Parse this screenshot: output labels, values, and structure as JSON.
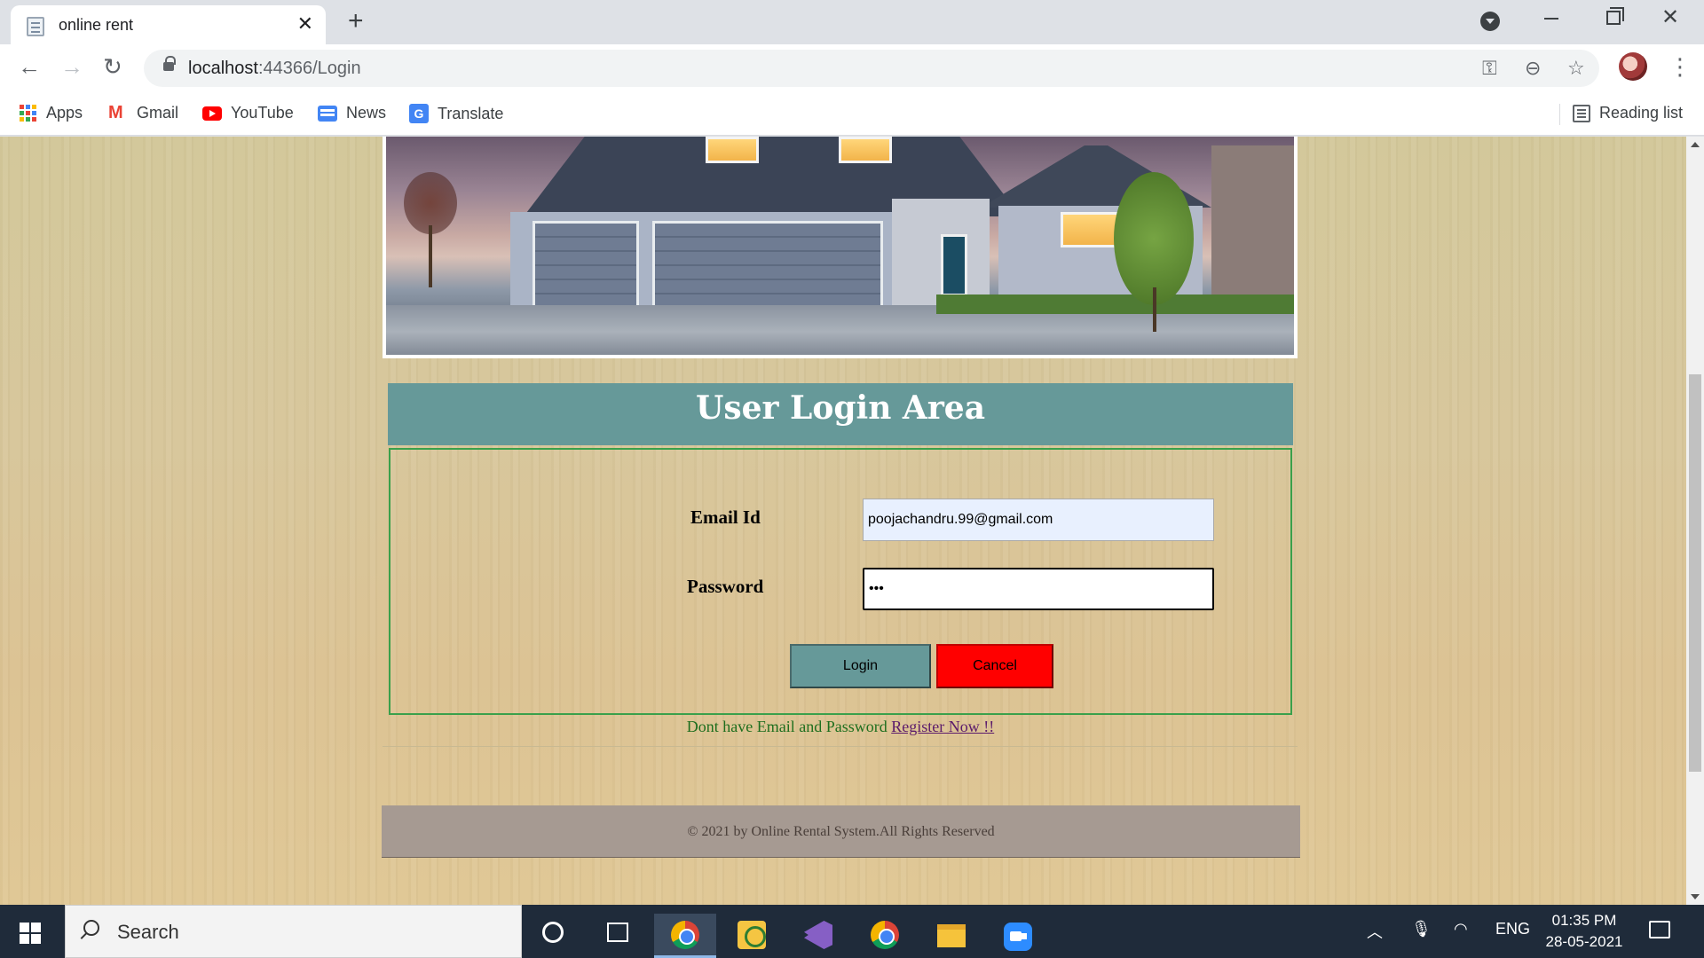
{
  "browser": {
    "tab_title": "online rent",
    "url_host": "localhost",
    "url_path": ":44366/Login",
    "bookmarks": [
      "Apps",
      "Gmail",
      "YouTube",
      "News",
      "Translate"
    ],
    "reading_list": "Reading list"
  },
  "page": {
    "login_title": "User Login Area",
    "email_label": "Email Id",
    "email_value": "poojachandru.99@gmail.com",
    "password_label": "Password",
    "password_value": "•••",
    "login_button": "Login",
    "cancel_button": "Cancel",
    "register_prompt": "Dont have Email and Password",
    "register_link": "Register Now !!",
    "footer": "© 2021 by Online Rental System.All Rights Reserved"
  },
  "taskbar": {
    "search_text": "Search",
    "language": "ENG",
    "time": "01:35 PM",
    "date": "28-05-2021"
  },
  "colors": {
    "login_header": "#669999",
    "cancel_button": "#ff0000",
    "footer_bg": "#a69a92"
  },
  "icons": [
    "page-icon",
    "close-icon",
    "plus-icon",
    "back-arrow-icon",
    "forward-arrow-icon",
    "reload-icon",
    "lock-icon",
    "key-icon",
    "zoom-out-icon",
    "star-icon",
    "apps-icon",
    "gmail-icon",
    "youtube-icon",
    "news-icon",
    "translate-icon",
    "reading-list-icon",
    "windows-start-icon",
    "search-icon",
    "cortana-icon",
    "task-view-icon",
    "chrome-icon",
    "visual-studio-icon",
    "file-explorer-icon",
    "zoom-app-icon",
    "microphone-icon",
    "wifi-icon",
    "notification-icon"
  ]
}
